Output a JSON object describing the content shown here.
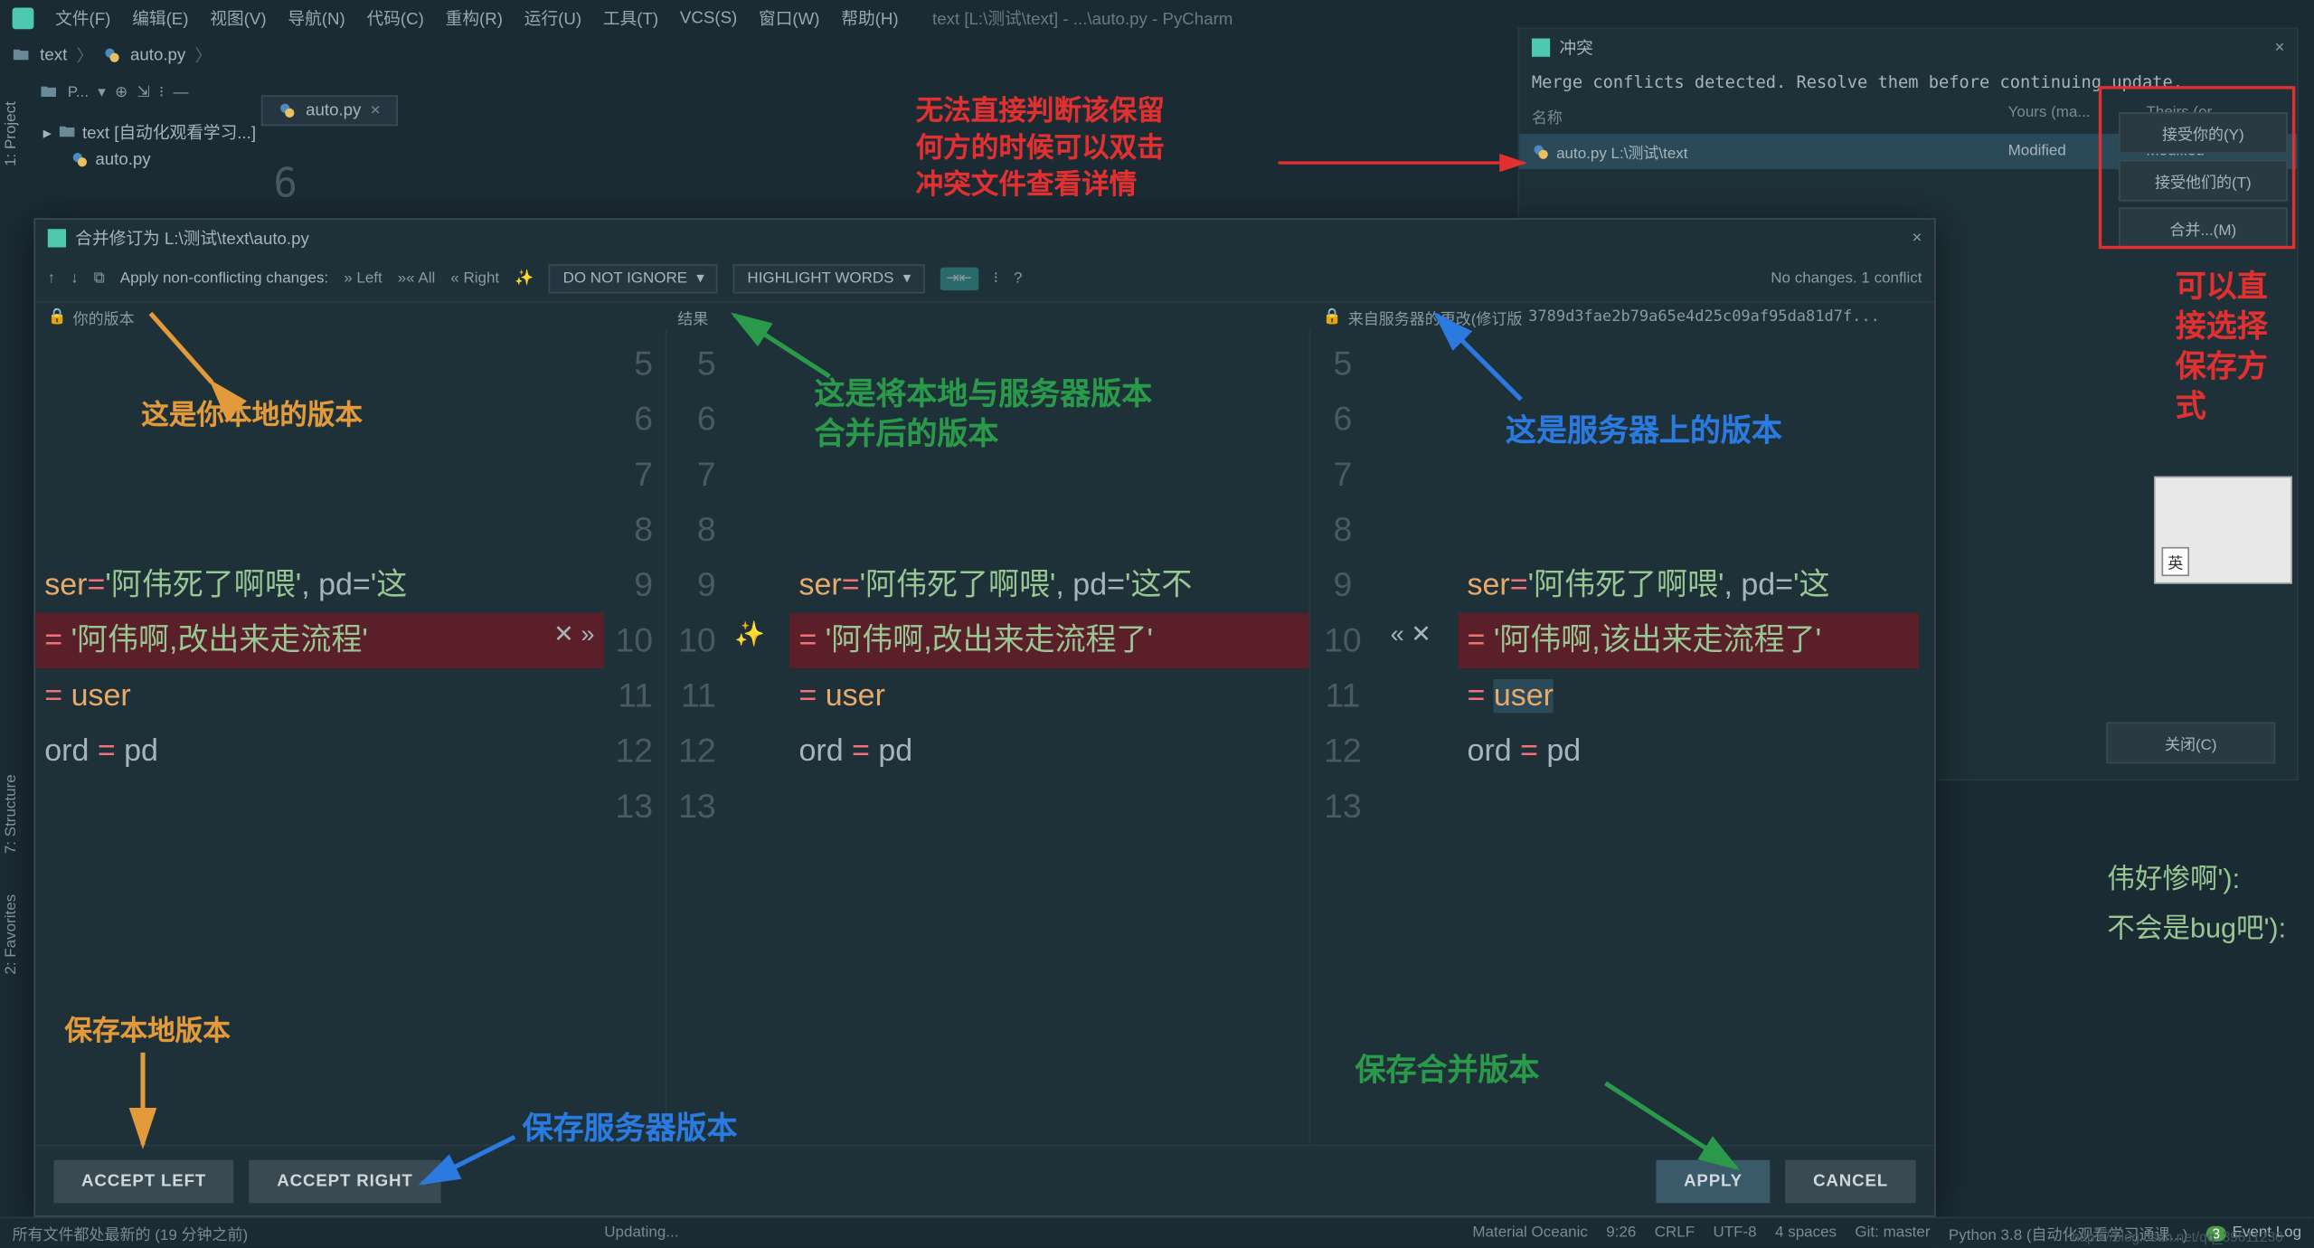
{
  "window": {
    "title_path": "text [L:\\测试\\text] - ...\\auto.py - PyCharm"
  },
  "menu": {
    "items": [
      "文件(F)",
      "编辑(E)",
      "视图(V)",
      "导航(N)",
      "代码(C)",
      "重构(R)",
      "运行(U)",
      "工具(T)",
      "VCS(S)",
      "窗口(W)",
      "帮助(H)"
    ]
  },
  "breadcrumb": {
    "root": "text",
    "file": "auto.py"
  },
  "left_tabs": {
    "project": "1: Project",
    "structure": "7: Structure",
    "favorites": "2: Favorites"
  },
  "project_tab": {
    "label": "P...",
    "tree_root": "text [自动化观看学习...]",
    "file": "auto.py"
  },
  "editor_tabs": [
    {
      "name": "auto.py"
    }
  ],
  "bg_line_num": "6",
  "conflicts_panel": {
    "title": "冲突",
    "message": "Merge conflicts detected. Resolve them before continuing update.",
    "cols": {
      "name": "名称",
      "yours": "Yours (ma...",
      "theirs": "Theirs (or..."
    },
    "row": {
      "name": "auto.py L:\\测试\\text",
      "yours": "Modified",
      "theirs": "Modified"
    },
    "btns": {
      "accept_yours": "接受你的(Y)",
      "accept_theirs": "接受他们的(T)",
      "merge": "合并...(M)",
      "close": "关闭(C)"
    }
  },
  "merge_dialog": {
    "title": "合并修订为 L:\\测试\\text\\auto.py",
    "apply_nc": "Apply non-conflicting changes:",
    "left_btn": "Left",
    "all_btn": "All",
    "right_btn": "Right",
    "ignore_dd": "DO NOT IGNORE",
    "highlight_dd": "HIGHLIGHT WORDS",
    "status": "No changes. 1 conflict",
    "pane_labels": {
      "yours": "你的版本",
      "result": "结果",
      "theirs_prefix": "来自服务器的更改(修订版",
      "revision": "3789d3fae2b79a65e4d25c09af95da81d7f..."
    },
    "buttons": {
      "accept_left": "ACCEPT LEFT",
      "accept_right": "ACCEPT RIGHT",
      "apply": "APPLY",
      "cancel": "CANCEL"
    },
    "lines": {
      "nums": [
        "5",
        "6",
        "7",
        "8",
        "9",
        "10",
        "11",
        "12",
        "13"
      ],
      "l9": {
        "a": "ser=",
        "s1": "'阿伟死了啊喂'",
        "b": ", pd=",
        "s2": "'这"
      },
      "left10": "'阿伟啊,改出来走流程'",
      "mid10": "'阿伟啊,改出来走流程了'",
      "right10": "'阿伟啊,该出来走流程了'",
      "l11": "= user",
      "l12": "ord = pd"
    }
  },
  "annotations": {
    "a1": "无法直接判断该保留\n何方的时候可以双击\n冲突文件查看详情",
    "a2": "可以直\n接选择\n保存方\n式",
    "yours": "这是你本地的版本",
    "result": "这是将本地与服务器版本\n合并后的版本",
    "server": "这是服务器上的版本",
    "save_local": "保存本地版本",
    "save_server": "保存服务器版本",
    "save_merge": "保存合并版本"
  },
  "bg_code": {
    "l1": "伟好惨啊'):",
    "l2": "不会是bug吧'):"
  },
  "avatar_label": "英",
  "statusbar": {
    "left_msg": "所有文件都处最新的 (19 分钟之前)",
    "updating": "Updating...",
    "theme": "Material Oceanic",
    "pos": "9:26",
    "crlf": "CRLF",
    "enc": "UTF-8",
    "spaces": "4 spaces",
    "git": "Git: master",
    "py": "Python 3.8 (自动化观看学习通课...)",
    "event_log": "Event Log",
    "badge": "3"
  },
  "watermark": "https://blog.csdn.net/qq_39611230"
}
